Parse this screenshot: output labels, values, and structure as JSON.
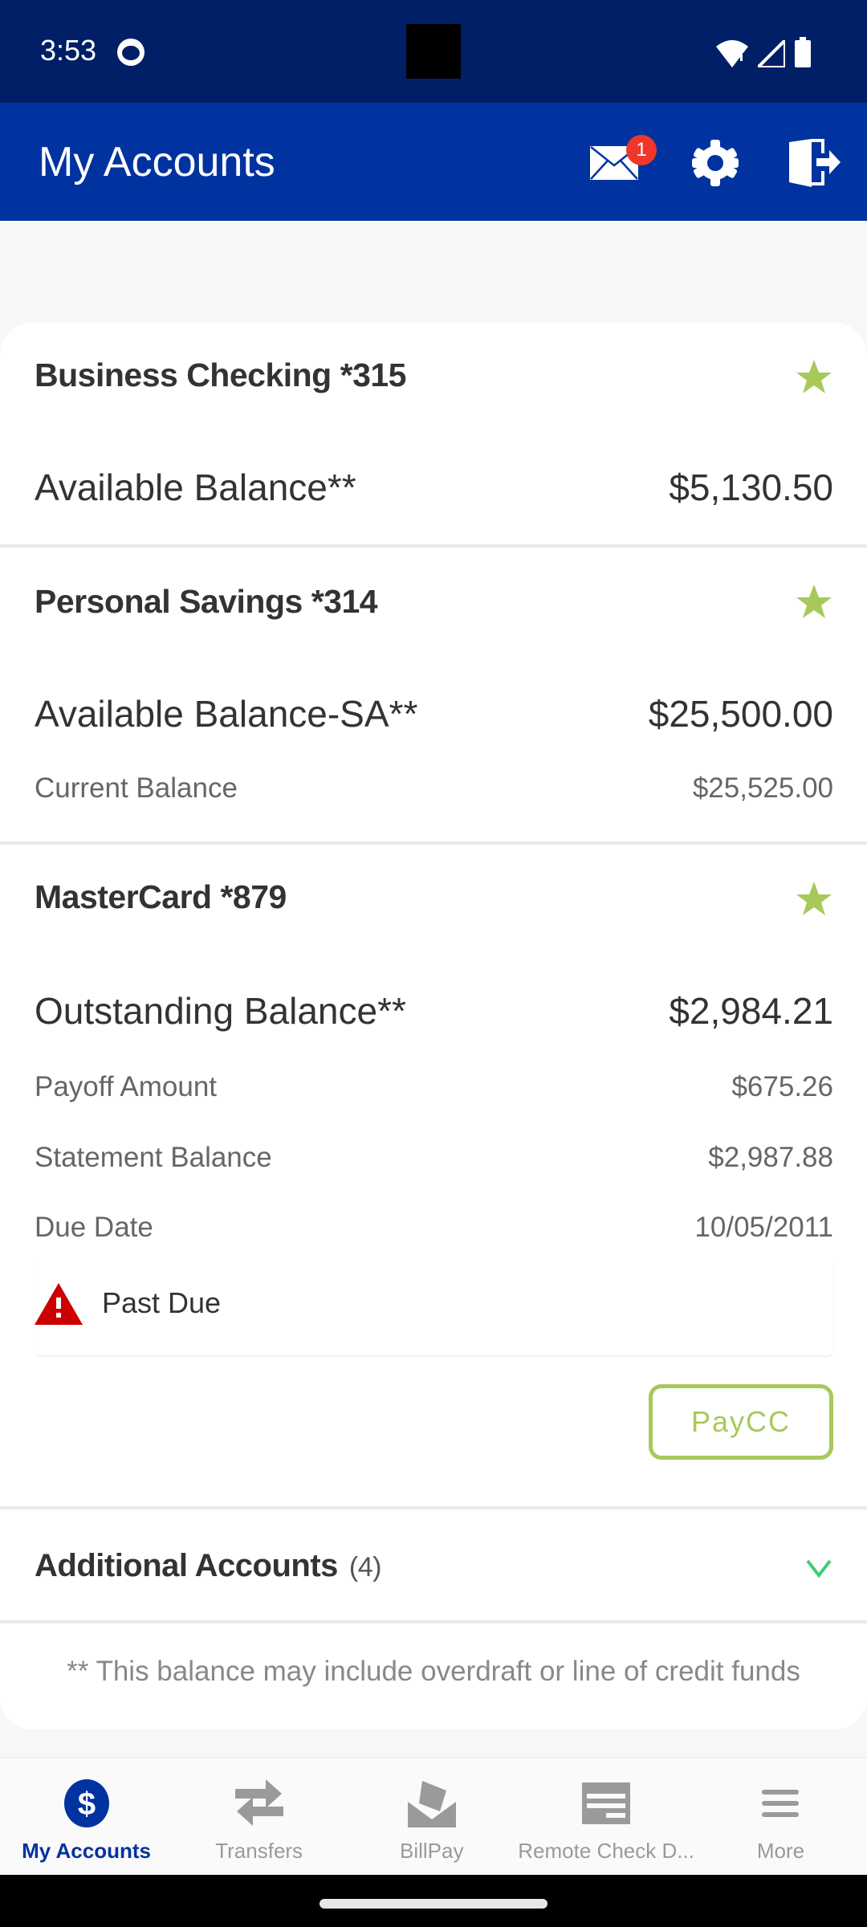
{
  "status_bar": {
    "time": "3:53"
  },
  "header": {
    "title": "My Accounts",
    "mail_badge_count": "1",
    "icons": [
      "mail-icon",
      "gear-icon",
      "logout-icon"
    ]
  },
  "accounts": [
    {
      "name": "Business Checking *315",
      "favorite": true,
      "rows": [
        {
          "label": "Available Balance**",
          "value": "$5,130.50",
          "style": "primary"
        }
      ]
    },
    {
      "name": "Personal Savings *314",
      "favorite": true,
      "rows": [
        {
          "label": "Available Balance-SA**",
          "value": "$25,500.00",
          "style": "primary"
        },
        {
          "label": "Current Balance",
          "value": "$25,525.00",
          "style": "secondary"
        }
      ]
    },
    {
      "name": "MasterCard *879",
      "favorite": true,
      "rows": [
        {
          "label": "Outstanding Balance**",
          "value": "$2,984.21",
          "style": "primary"
        },
        {
          "label": "Payoff Amount",
          "value": "$675.26",
          "style": "secondary"
        },
        {
          "label": "Statement Balance",
          "value": "$2,987.88",
          "style": "secondary"
        },
        {
          "label": "Due Date",
          "value": "10/05/2011",
          "style": "secondary"
        }
      ],
      "alert": "Past Due",
      "action_label": "PayCC"
    }
  ],
  "additional_accounts": {
    "label": "Additional Accounts",
    "count": "(4)"
  },
  "footnote": "** This balance may include overdraft or line of credit funds",
  "bottom_nav": [
    {
      "label": "My Accounts",
      "icon": "dollar-icon",
      "active": true
    },
    {
      "label": "Transfers",
      "icon": "transfer-arrows-icon",
      "active": false
    },
    {
      "label": "BillPay",
      "icon": "billpay-envelope-icon",
      "active": false
    },
    {
      "label": "Remote Check D...",
      "icon": "check-deposit-icon",
      "active": false
    },
    {
      "label": "More",
      "icon": "menu-icon",
      "active": false
    }
  ],
  "colors": {
    "status_bar": "#001f66",
    "app_bar": "#0033a0",
    "accent_green": "#a7c95a",
    "alert_red": "#cc0000",
    "badge_red": "#f0372a",
    "chevron_green": "#3ccf7a"
  }
}
